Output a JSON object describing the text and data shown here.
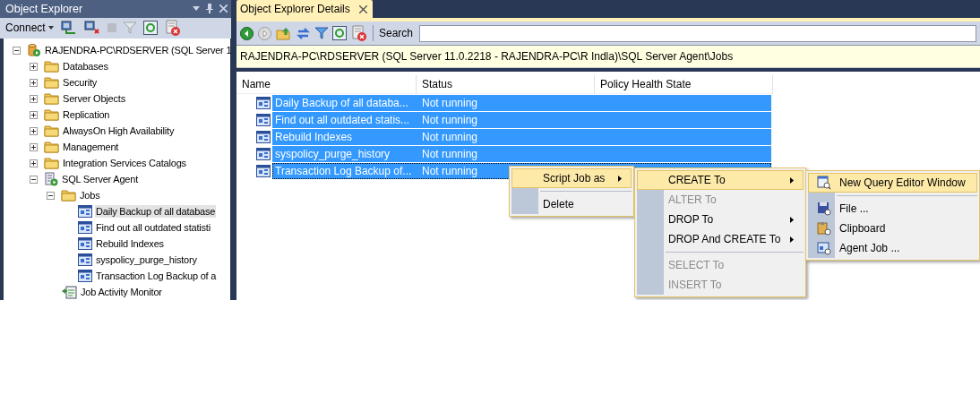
{
  "object_explorer": {
    "title": "Object Explorer",
    "toolbar": {
      "connect": "Connect"
    },
    "tree": [
      {
        "label": "RAJENDRA-PC\\RDSERVER (SQL Server 1",
        "kind": "server",
        "expanded": true,
        "selected": false,
        "children": [
          {
            "label": "Databases",
            "kind": "folder",
            "expanded": false,
            "selected": false
          },
          {
            "label": "Security",
            "kind": "folder",
            "expanded": false,
            "selected": false
          },
          {
            "label": "Server Objects",
            "kind": "folder",
            "expanded": false,
            "selected": false
          },
          {
            "label": "Replication",
            "kind": "folder",
            "expanded": false,
            "selected": false
          },
          {
            "label": "AlwaysOn High Availability",
            "kind": "folder",
            "expanded": false,
            "selected": false
          },
          {
            "label": "Management",
            "kind": "folder",
            "expanded": false,
            "selected": false
          },
          {
            "label": "Integration Services Catalogs",
            "kind": "folder",
            "expanded": false,
            "selected": false
          },
          {
            "label": "SQL Server Agent",
            "kind": "agent",
            "expanded": true,
            "selected": false,
            "children": [
              {
                "label": "Jobs",
                "kind": "folder",
                "expanded": true,
                "selected": false,
                "children": [
                  {
                    "label": "Daily Backup of all database",
                    "kind": "job",
                    "selected": true
                  },
                  {
                    "label": "Find out all outdated statisti",
                    "kind": "job",
                    "selected": false
                  },
                  {
                    "label": "Rebuild Indexes",
                    "kind": "job",
                    "selected": false
                  },
                  {
                    "label": "syspolicy_purge_history",
                    "kind": "job",
                    "selected": false
                  },
                  {
                    "label": "Transaction Log Backup of a",
                    "kind": "job",
                    "selected": false
                  }
                ]
              },
              {
                "label": "Job Activity Monitor",
                "kind": "monitor",
                "selected": false
              }
            ]
          }
        ]
      }
    ]
  },
  "details": {
    "tab": {
      "label": "Object Explorer Details"
    },
    "search": {
      "label": "Search"
    },
    "path": "RAJENDRA-PC\\RDSERVER (SQL Server 11.0.2218 - RAJENDRA-PC\\R Indla)\\SQL Server Agent\\Jobs",
    "table": {
      "columns": [
        "Name",
        "Status",
        "Policy Health State"
      ],
      "rows": [
        {
          "name": "Daily Backup of all databa...",
          "status": "Not running",
          "selected": true,
          "focused": false
        },
        {
          "name": "Find out all outdated statis...",
          "status": "Not running",
          "selected": true,
          "focused": false
        },
        {
          "name": "Rebuild Indexes",
          "status": "Not running",
          "selected": true,
          "focused": false
        },
        {
          "name": "syspolicy_purge_history",
          "status": "Not running",
          "selected": true,
          "focused": false
        },
        {
          "name": "Transaction Log Backup of...",
          "status": "Not running",
          "selected": true,
          "focused": true
        }
      ]
    }
  },
  "context_menus": [
    {
      "items": [
        {
          "kind": "item",
          "label": "Script Job as",
          "highlighted": true,
          "disabled": false,
          "submenu": true
        },
        {
          "kind": "separator"
        },
        {
          "kind": "item",
          "label": "Delete",
          "highlighted": false,
          "disabled": false,
          "submenu": false
        }
      ]
    },
    {
      "items": [
        {
          "kind": "item",
          "label": "CREATE To",
          "highlighted": true,
          "disabled": false,
          "submenu": true
        },
        {
          "kind": "item",
          "label": "ALTER To",
          "highlighted": false,
          "disabled": true,
          "submenu": false
        },
        {
          "kind": "item",
          "label": "DROP To",
          "highlighted": false,
          "disabled": false,
          "submenu": true
        },
        {
          "kind": "item",
          "label": "DROP And CREATE To",
          "highlighted": false,
          "disabled": false,
          "submenu": true
        },
        {
          "kind": "separator"
        },
        {
          "kind": "item",
          "label": "SELECT To",
          "highlighted": false,
          "disabled": true,
          "submenu": false
        },
        {
          "kind": "item",
          "label": "INSERT To",
          "highlighted": false,
          "disabled": true,
          "submenu": false
        }
      ]
    },
    {
      "items": [
        {
          "kind": "item",
          "label": "New Query Editor Window",
          "highlighted": true,
          "disabled": false,
          "submenu": false
        },
        {
          "kind": "separator"
        },
        {
          "kind": "item",
          "label": "File ...",
          "highlighted": false,
          "disabled": false,
          "submenu": false
        },
        {
          "kind": "item",
          "label": "Clipboard",
          "highlighted": false,
          "disabled": false,
          "submenu": false
        },
        {
          "kind": "item",
          "label": "Agent Job ...",
          "highlighted": false,
          "disabled": false,
          "submenu": false
        }
      ]
    }
  ]
}
